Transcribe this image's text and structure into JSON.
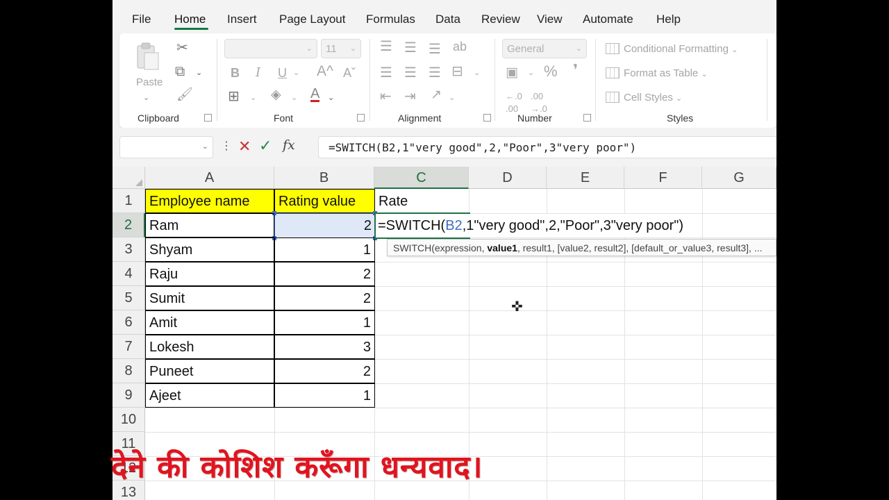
{
  "menu": {
    "tabs": [
      "File",
      "Home",
      "Insert",
      "Page Layout",
      "Formulas",
      "Data",
      "Review",
      "View",
      "Automate",
      "Help"
    ],
    "active_tab": "Home"
  },
  "ribbon": {
    "clipboard": {
      "label": "Clipboard",
      "paste_label": "Paste"
    },
    "font": {
      "label": "Font",
      "size_value": "11",
      "font_value": ""
    },
    "alignment": {
      "label": "Alignment"
    },
    "number": {
      "label": "Number",
      "format_value": "General"
    },
    "styles": {
      "label": "Styles",
      "conditional_formatting": "Conditional Formatting",
      "format_as_table": "Format as Table",
      "cell_styles": "Cell Styles"
    }
  },
  "formula_bar": {
    "name_box": "",
    "formula": "=SWITCH(B2,1\"very good\",2,\"Poor\",3\"very poor\")"
  },
  "columns": [
    "A",
    "B",
    "C",
    "D",
    "E",
    "F",
    "G"
  ],
  "rows": [
    "1",
    "2",
    "3",
    "4",
    "5",
    "6",
    "7",
    "8",
    "9",
    "10",
    "11",
    "12",
    "13"
  ],
  "sheet": {
    "headers": [
      "Employee name",
      "Rating value",
      "Rate"
    ],
    "data": [
      {
        "name": "Ram",
        "rating": "2"
      },
      {
        "name": "Shyam",
        "rating": "1"
      },
      {
        "name": "Raju",
        "rating": "2"
      },
      {
        "name": "Sumit",
        "rating": "2"
      },
      {
        "name": "Amit",
        "rating": "1"
      },
      {
        "name": "Lokesh",
        "rating": "3"
      },
      {
        "name": "Puneet",
        "rating": "2"
      },
      {
        "name": "Ajeet",
        "rating": "1"
      }
    ],
    "editing": {
      "prefix": "=SWITCH(",
      "ref": "B2",
      "suffix": ",1\"very good\",2,\"Poor\",3\"very poor\")"
    }
  },
  "tooltip": {
    "func": "SWITCH(expression, ",
    "bold_arg": "value1",
    "rest": ", result1, [value2, result2], [default_or_value3, result3], ..."
  },
  "overlay_text": "देने की कोशिश करूँगा धन्यवाद।",
  "colors": {
    "accent": "#1e7145",
    "header_fill": "#ffff00",
    "selection": "#3d6ec7",
    "overlay": "#e0141f"
  }
}
